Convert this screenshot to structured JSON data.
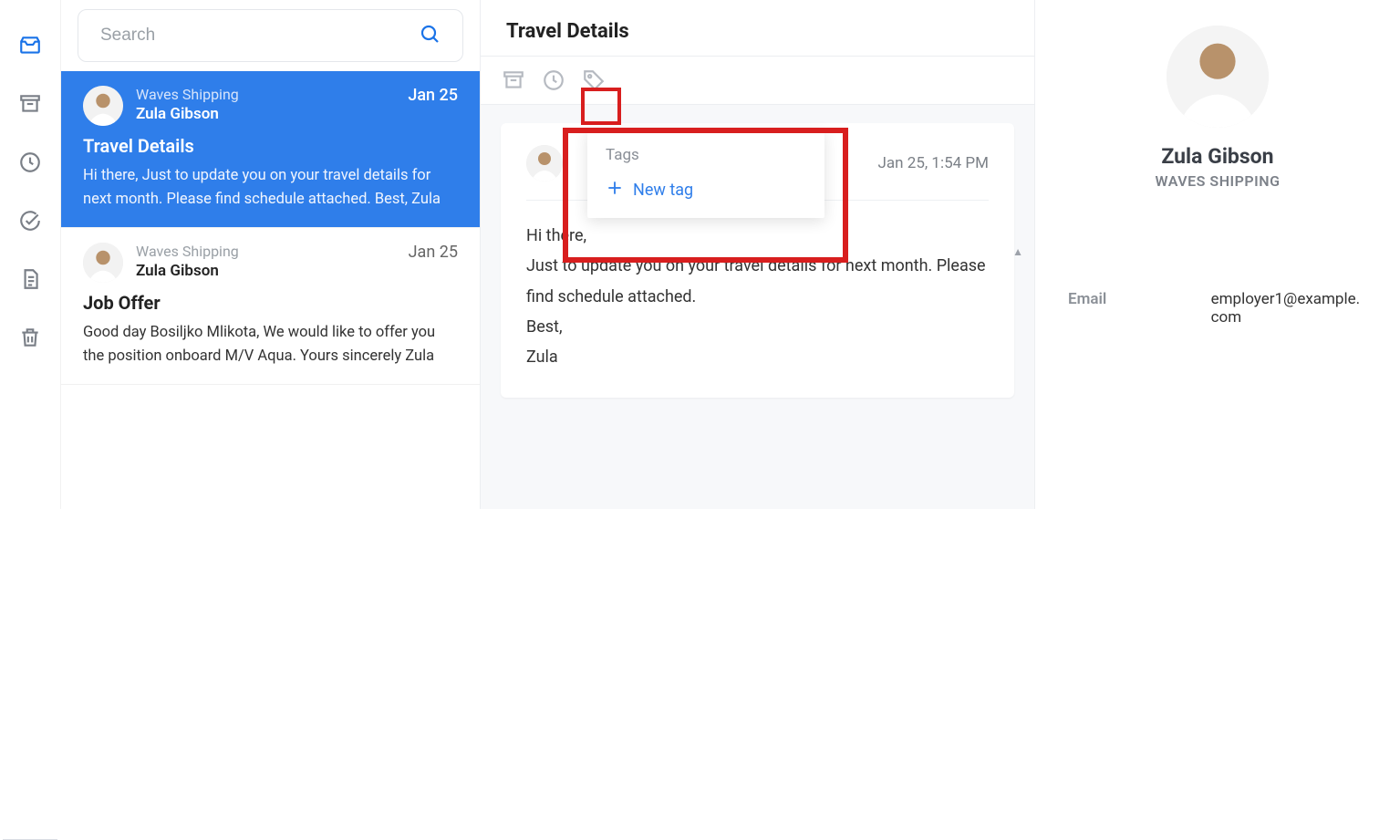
{
  "search": {
    "placeholder": "Search"
  },
  "messages": [
    {
      "company": "Waves Shipping",
      "sender": "Zula Gibson",
      "date": "Jan 25",
      "subject": "Travel Details",
      "preview": "Hi there, Just to update you on your travel details for next month. Please find schedule attached. Best, Zula"
    },
    {
      "company": "Waves Shipping",
      "sender": "Zula Gibson",
      "date": "Jan 25",
      "subject": "Job Offer",
      "preview": "Good day Bosiljko Mlikota, We would like to offer you the position onboard M/V Aqua. Yours sincerely Zula"
    }
  ],
  "detail": {
    "title": "Travel Details",
    "timestamp": "Jan 25, 1:54 PM",
    "body": "Hi there,\nJust to update you on your travel details for next month. Please find schedule attached.\nBest,\nZula"
  },
  "tags_popover": {
    "title": "Tags",
    "new_tag_label": "New tag"
  },
  "contact": {
    "name": "Zula Gibson",
    "org": "WAVES SHIPPING",
    "email_label": "Email",
    "email_value": "employer1@example.com"
  }
}
